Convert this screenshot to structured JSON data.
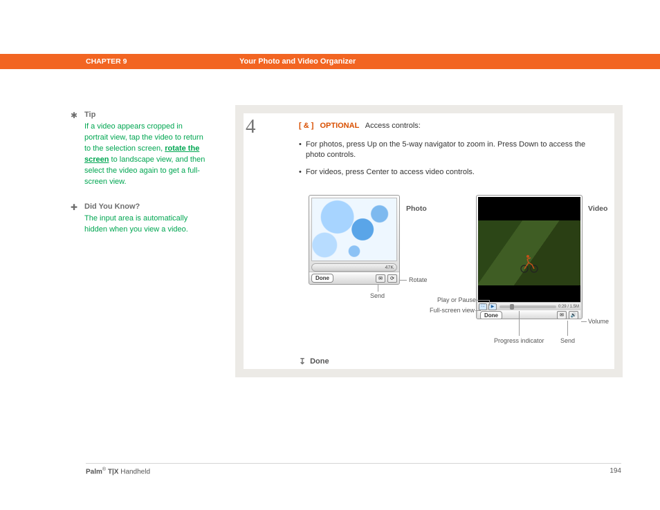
{
  "header": {
    "chapter": "CHAPTER 9",
    "title": "Your Photo and Video Organizer"
  },
  "sidebar": {
    "tip": {
      "heading": "Tip",
      "text_before": "If a video appears cropped in portrait view, tap the video to return to the selection screen, ",
      "link": "rotate the screen",
      "text_after": " to landscape view, and then select the video again to get a full-screen view."
    },
    "dyk": {
      "heading": "Did You Know?",
      "text": "The input area is automatically hidden when you view a video."
    }
  },
  "step": {
    "number": "4",
    "optional_bracket_open": "[ & ]",
    "optional_label": "OPTIONAL",
    "optional_text": "Access controls:",
    "bullets": [
      "For photos, press Up on the 5-way navigator to zoom in. Press Down to access the photo controls.",
      "For videos, press Center to access video controls."
    ],
    "photo_label": "Photo",
    "video_label": "Video",
    "photo_ui": {
      "done": "Done",
      "size": "47K"
    },
    "video_ui": {
      "done": "Done",
      "time": "0:29 / 1.5M"
    },
    "callouts": {
      "rotate": "Rotate",
      "send_photo": "Send",
      "play_pause": "Play or Pause",
      "fullscreen": "Full-screen view",
      "progress": "Progress indicator",
      "send_video": "Send",
      "volume": "Volume"
    },
    "done": "Done"
  },
  "footer": {
    "brand": "Palm",
    "model": " T|X",
    "suffix": " Handheld",
    "page": "194"
  }
}
